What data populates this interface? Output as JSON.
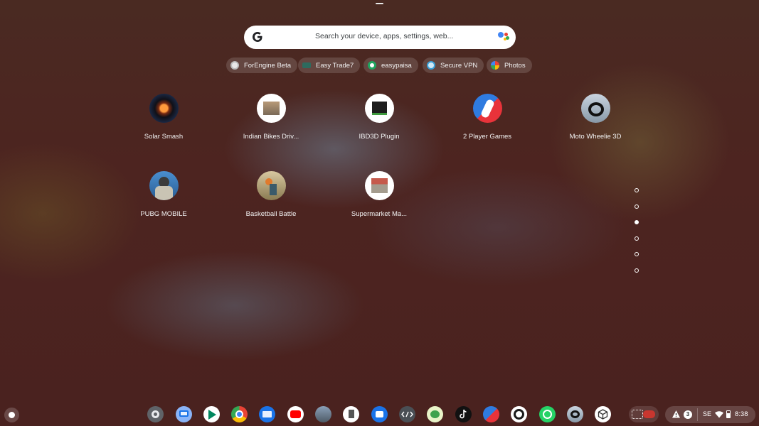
{
  "search": {
    "placeholder": "Search your device, apps, settings, web..."
  },
  "suggestions": [
    {
      "label": "ForEngine Beta",
      "icon": "forengine-icon"
    },
    {
      "label": "Easy Trade7",
      "icon": "easy-trade-icon"
    },
    {
      "label": "easypaisa",
      "icon": "easypaisa-icon"
    },
    {
      "label": "Secure VPN",
      "icon": "vpn-icon"
    },
    {
      "label": "Photos",
      "icon": "photos-icon"
    }
  ],
  "apps": [
    {
      "label": "Solar Smash",
      "icon": "solar-smash-icon"
    },
    {
      "label": "Indian Bikes Driv...",
      "icon": "indian-bikes-icon"
    },
    {
      "label": "IBD3D Plugin",
      "icon": "ibd3d-plugin-icon"
    },
    {
      "label": "2 Player Games",
      "icon": "two-player-games-icon"
    },
    {
      "label": "Moto Wheelie 3D",
      "icon": "moto-wheelie-icon"
    },
    {
      "label": "PUBG MOBILE",
      "icon": "pubg-icon"
    },
    {
      "label": "Basketball Battle",
      "icon": "basketball-battle-icon"
    },
    {
      "label": "Supermarket Ma...",
      "icon": "supermarket-icon"
    }
  ],
  "pager": {
    "pages": 6,
    "active_index": 2
  },
  "shelf": [
    "settings-icon",
    "chromebook-tips-icon",
    "play-store-icon",
    "chrome-icon",
    "files-icon",
    "youtube-icon",
    "pubg-shelf-icon",
    "docs-icon",
    "camera-icon",
    "terminal-icon",
    "android-game-icon",
    "tiktok-icon",
    "two-player-shelf-icon",
    "easypaisa-shelf-icon",
    "whatsapp-icon",
    "moto-shelf-icon",
    "cube-app-icon",
    "screen-capture-icon"
  ],
  "tray": {
    "notification_count": "3",
    "ime": "SE",
    "time": "8:38"
  },
  "colors": {
    "search_bg": "#ffffff",
    "chip_bg": "rgba(255,255,255,0.14)",
    "wallpaper": "#4b2420"
  }
}
